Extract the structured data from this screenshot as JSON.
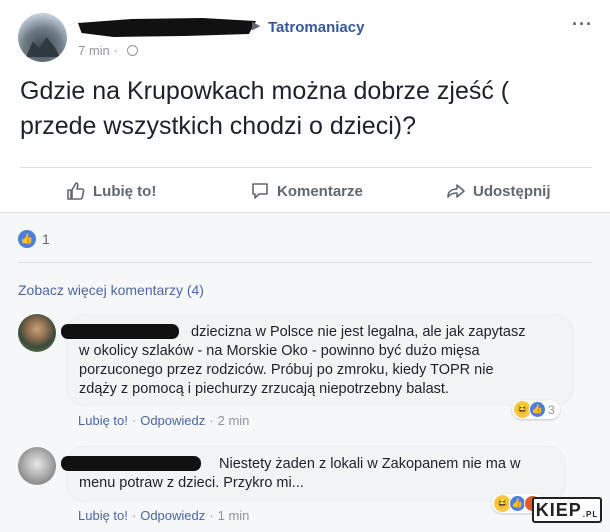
{
  "header": {
    "group_name": "Tatromaniacy",
    "time": "7 min ·",
    "more": "···"
  },
  "post": {
    "text_line1": "Gdzie na Krupowkach można dobrze zjeść (",
    "text_line2": "przede wszystkich chodzi o dzieci)?"
  },
  "actions": {
    "like": "Lubię to!",
    "comment": "Komentarze",
    "share": "Udostępnij"
  },
  "reactions": {
    "count": "1"
  },
  "comments_section": {
    "see_more": "Zobacz więcej komentarzy (4)"
  },
  "comments": [
    {
      "lines": [
        "dziecizna w Polsce nie jest legalna, ale jak zapytasz",
        "w okolicy szlaków - na Morskie Oko - powinno być dużo mięsa",
        "porzuconego przez rodziców. Próbuj po zmroku, kiedy TOPR nie",
        "zdąży z pomocą i piechurzy zrzucają niepotrzebny balast."
      ],
      "like": "Lubię to!",
      "reply": "Odpowiedz",
      "sep": "·",
      "time": "2 min",
      "reaction_count": "3"
    },
    {
      "lines": [
        "Niestety żaden z lokali w Zakopanem nie ma w",
        "menu potraw z dzieci. Przykro mi..."
      ],
      "like": "Lubię to!",
      "reply": "Odpowiedz",
      "sep": "·",
      "time": "1 min"
    }
  ],
  "watermark": {
    "text": "KIEP",
    "suffix": ".PL"
  },
  "colors": {
    "link": "#365899",
    "meta_link": "#4b67a1",
    "gray": "#90949c",
    "like_blue": "#4a7fdc"
  }
}
